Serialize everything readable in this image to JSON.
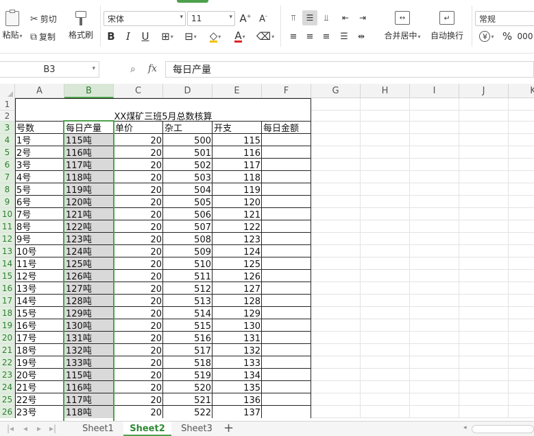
{
  "ribbon": {
    "paste_label": "粘贴",
    "cut_label": "剪切",
    "copy_label": "复制",
    "format_painter_label": "格式刷",
    "font_name": "宋体",
    "font_size": "11",
    "bold": "B",
    "italic": "I",
    "underline": "U",
    "merge_center_label": "合并居中",
    "wrap_text_label": "自动换行",
    "number_format": "常规",
    "percent": "%",
    "currency": "¥"
  },
  "formula_bar": {
    "name_box": "B3",
    "fx_label": "fx",
    "formula": "每日产量"
  },
  "columns": [
    "A",
    "B",
    "C",
    "D",
    "E",
    "F",
    "G",
    "H",
    "I",
    "J",
    "K"
  ],
  "rows": [
    "1",
    "2",
    "3",
    "4",
    "5",
    "6",
    "7",
    "8",
    "9",
    "10",
    "11",
    "12",
    "13",
    "14",
    "15",
    "16",
    "17",
    "18",
    "19",
    "20",
    "21",
    "22",
    "23",
    "24",
    "25",
    "26"
  ],
  "sheet": {
    "title": "XX煤矿三班5月总数核算",
    "headers": [
      "号数",
      "每日产量",
      "单价",
      "杂工",
      "开支",
      "每日金额"
    ],
    "data": [
      [
        "1号",
        "115吨",
        "20",
        "500",
        "115",
        ""
      ],
      [
        "2号",
        "116吨",
        "20",
        "501",
        "116",
        ""
      ],
      [
        "3号",
        "117吨",
        "20",
        "502",
        "117",
        ""
      ],
      [
        "4号",
        "118吨",
        "20",
        "503",
        "118",
        ""
      ],
      [
        "5号",
        "119吨",
        "20",
        "504",
        "119",
        ""
      ],
      [
        "6号",
        "120吨",
        "20",
        "505",
        "120",
        ""
      ],
      [
        "7号",
        "121吨",
        "20",
        "506",
        "121",
        ""
      ],
      [
        "8号",
        "122吨",
        "20",
        "507",
        "122",
        ""
      ],
      [
        "9号",
        "123吨",
        "20",
        "508",
        "123",
        ""
      ],
      [
        "10号",
        "124吨",
        "20",
        "509",
        "124",
        ""
      ],
      [
        "11号",
        "125吨",
        "20",
        "510",
        "125",
        ""
      ],
      [
        "12号",
        "126吨",
        "20",
        "511",
        "126",
        ""
      ],
      [
        "13号",
        "127吨",
        "20",
        "512",
        "127",
        ""
      ],
      [
        "14号",
        "128吨",
        "20",
        "513",
        "128",
        ""
      ],
      [
        "15号",
        "129吨",
        "20",
        "514",
        "129",
        ""
      ],
      [
        "16号",
        "130吨",
        "20",
        "515",
        "130",
        ""
      ],
      [
        "17号",
        "131吨",
        "20",
        "516",
        "131",
        ""
      ],
      [
        "18号",
        "132吨",
        "20",
        "517",
        "132",
        ""
      ],
      [
        "19号",
        "133吨",
        "20",
        "518",
        "133",
        ""
      ],
      [
        "20号",
        "115吨",
        "20",
        "519",
        "134",
        ""
      ],
      [
        "21号",
        "116吨",
        "20",
        "520",
        "135",
        ""
      ],
      [
        "22号",
        "117吨",
        "20",
        "521",
        "136",
        ""
      ],
      [
        "23号",
        "118吨",
        "20",
        "522",
        "137",
        ""
      ]
    ]
  },
  "sheet_tabs": [
    {
      "label": "Sheet1",
      "active": false
    },
    {
      "label": "Sheet2",
      "active": true
    },
    {
      "label": "Sheet3",
      "active": false
    }
  ],
  "colors": {
    "accent": "#4ca04c",
    "selection_fill": "#d9d9d9"
  }
}
